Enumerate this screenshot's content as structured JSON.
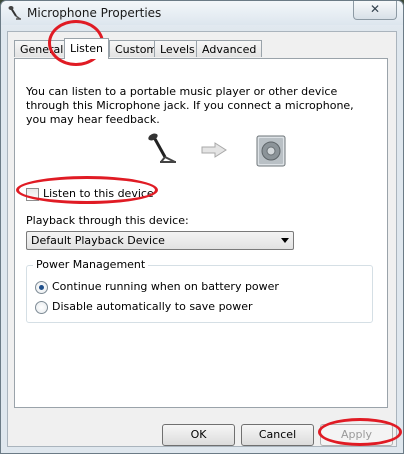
{
  "window": {
    "title": "Microphone Properties",
    "close_glyph": "✕"
  },
  "tabs": [
    {
      "label": "General"
    },
    {
      "label": "Listen"
    },
    {
      "label": "Custom"
    },
    {
      "label": "Levels"
    },
    {
      "label": "Advanced"
    }
  ],
  "listen": {
    "description": "You can listen to a portable music player or other device through this Microphone jack.  If you connect a microphone, you may hear feedback.",
    "listen_checkbox_label": "Listen to this device",
    "listen_checked": false,
    "playback_label": "Playback through this device:",
    "playback_selected": "Default Playback Device"
  },
  "power": {
    "group_title": "Power Management",
    "option_continue": "Continue running when on battery power",
    "option_disable": "Disable automatically to save power",
    "selected": "continue"
  },
  "buttons": {
    "ok": "OK",
    "cancel": "Cancel",
    "apply": "Apply"
  },
  "colors": {
    "annotation": "#e01b24",
    "accent": "#1f4f8a"
  },
  "icons": [
    "microphone-icon",
    "arrow-right-icon",
    "speaker-icon",
    "close-icon"
  ]
}
